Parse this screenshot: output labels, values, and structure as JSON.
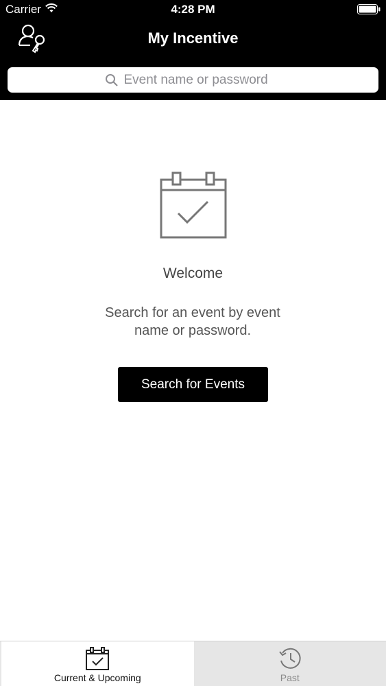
{
  "status_bar": {
    "carrier": "Carrier",
    "time": "4:28 PM",
    "wifi_icon": "wifi-icon",
    "battery_icon": "battery-full-icon"
  },
  "nav": {
    "title": "My Incentive",
    "left_icon": "user-key-icon"
  },
  "search": {
    "placeholder": "Event name or password",
    "value": ""
  },
  "empty_state": {
    "icon": "calendar-check-icon",
    "title": "Welcome",
    "description": "Search for an event by event name or password.",
    "button_label": "Search for Events"
  },
  "tabs": [
    {
      "label": "Current & Upcoming",
      "icon": "calendar-check-icon",
      "selected": true
    },
    {
      "label": "Past",
      "icon": "history-clock-icon",
      "selected": false
    }
  ],
  "colors": {
    "header_bg": "#000000",
    "button_bg": "#000000",
    "tab_inactive_bg": "#e6e6e6",
    "icon_gray": "#777777"
  }
}
